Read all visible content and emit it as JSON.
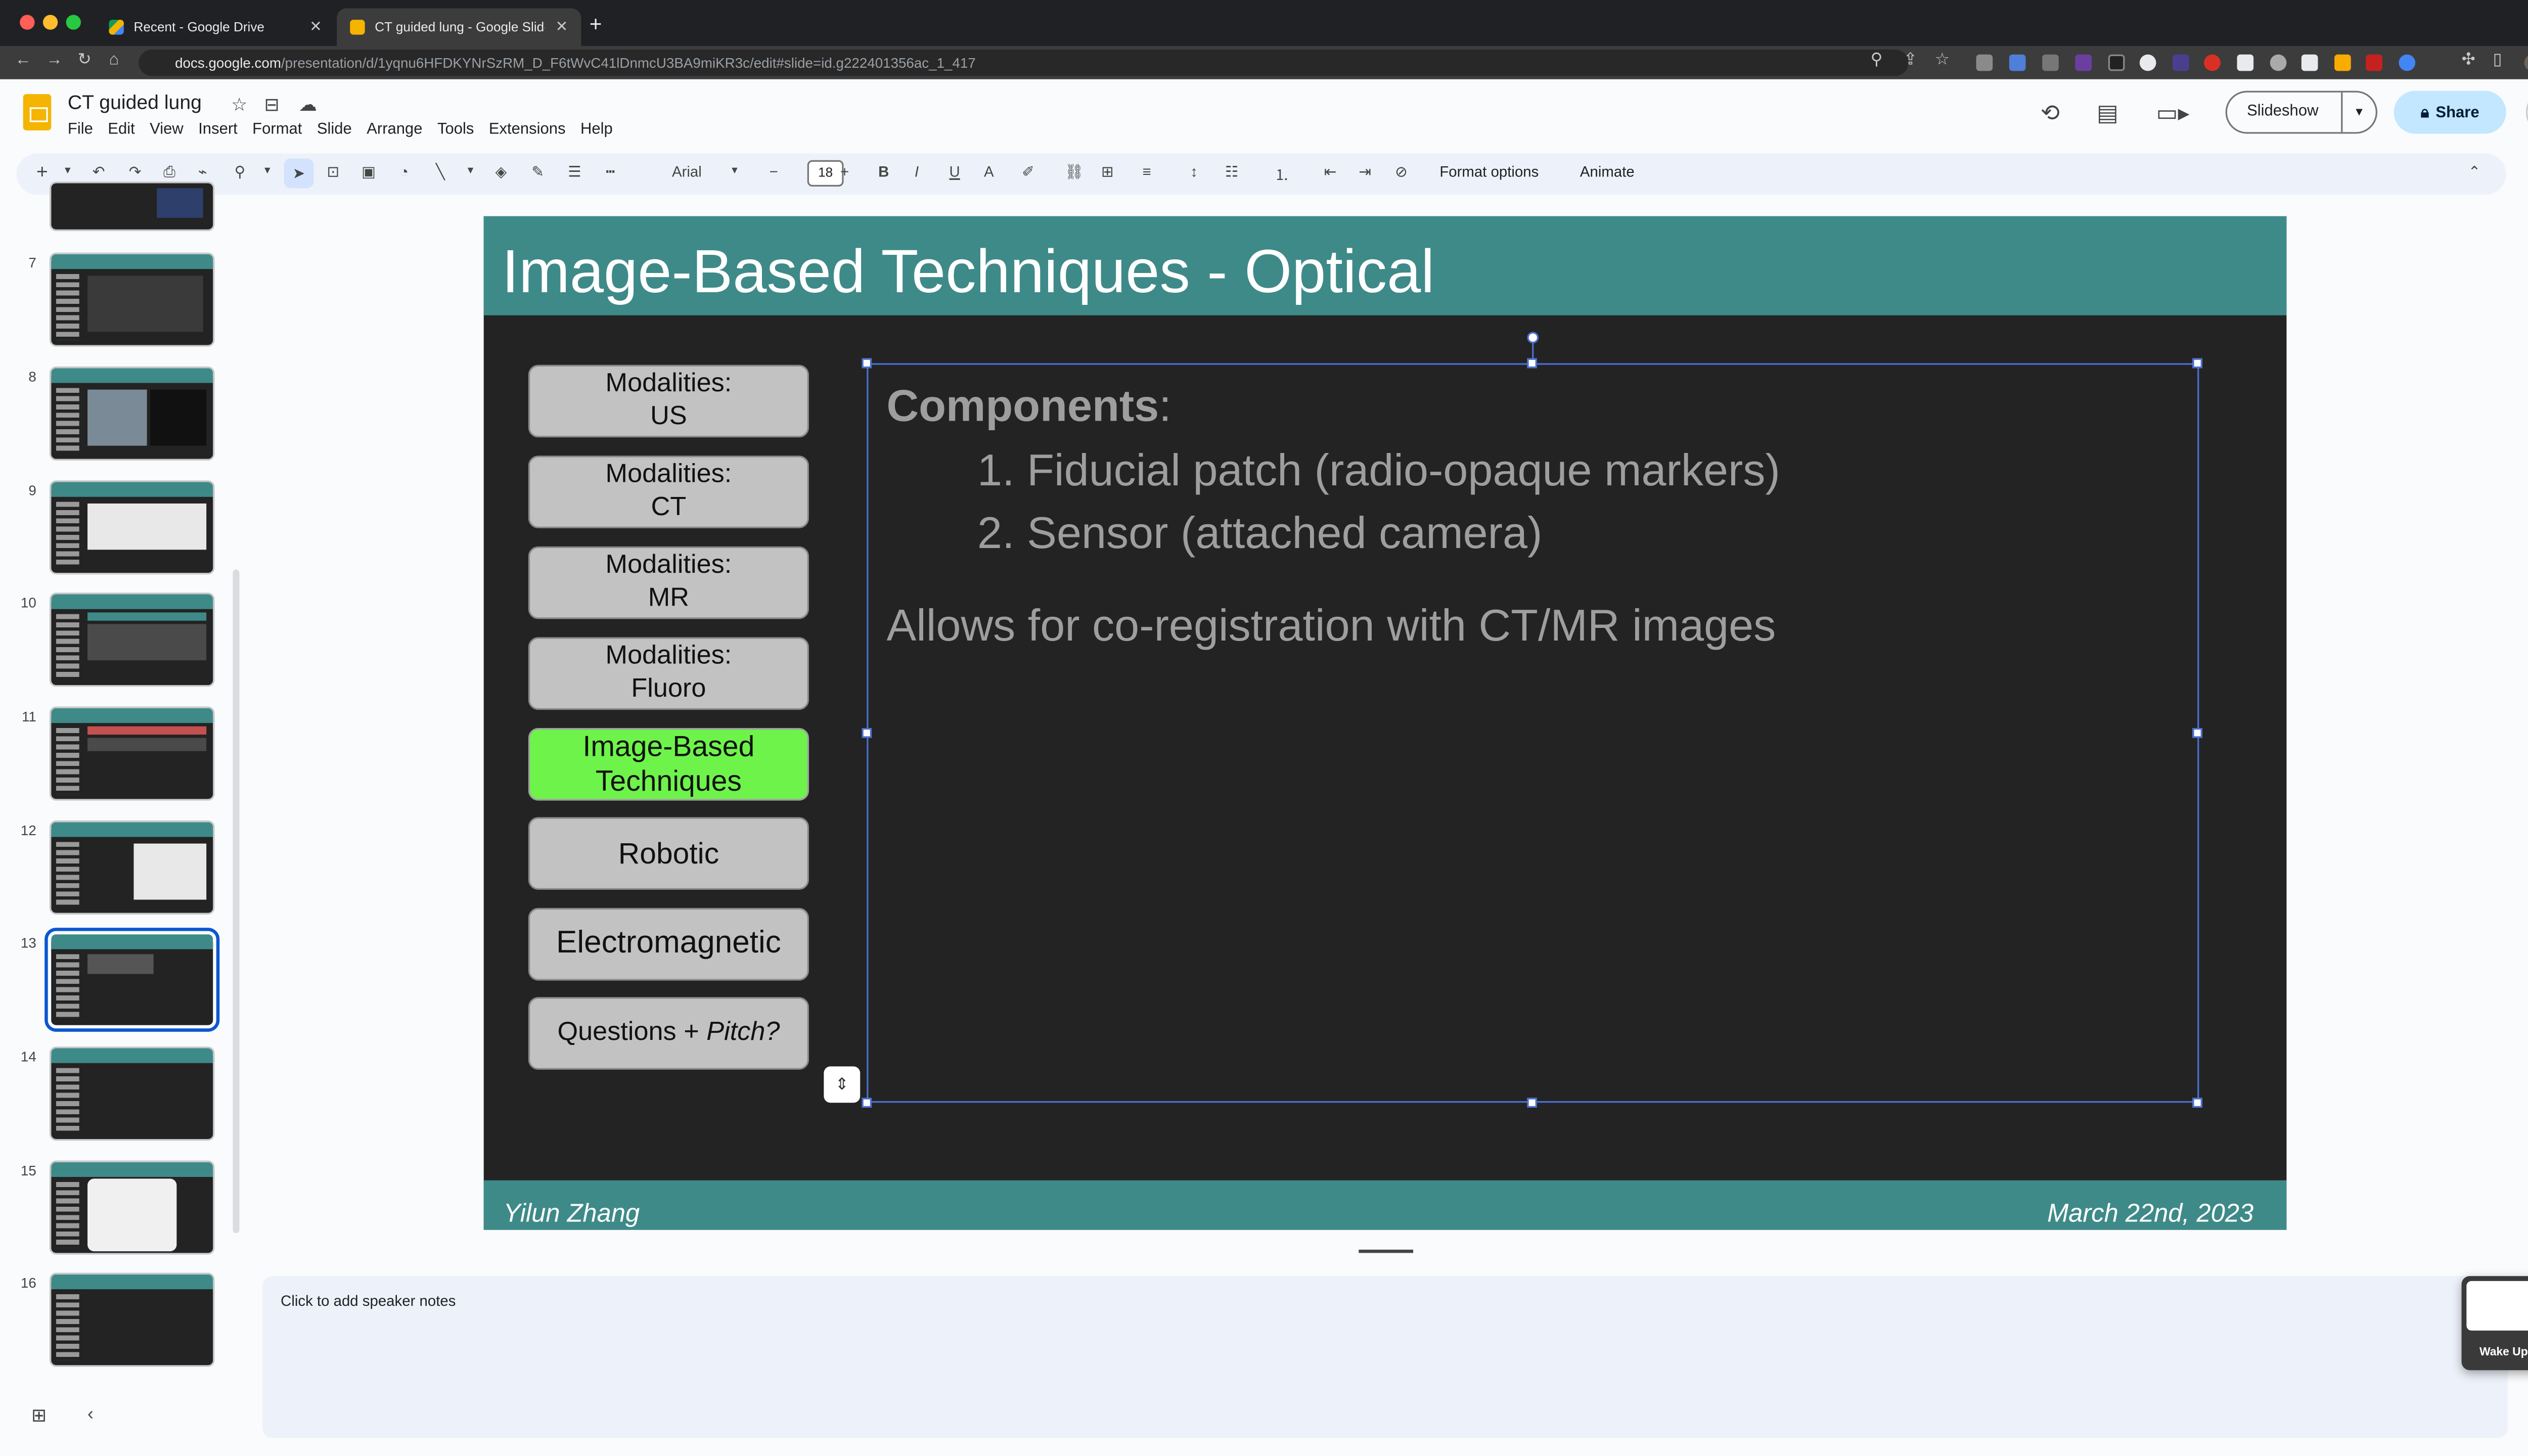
{
  "browser": {
    "tabs": [
      {
        "title": "Recent - Google Drive",
        "active": false
      },
      {
        "title": "CT guided lung - Google Slides",
        "active": true
      }
    ],
    "url_host": "docs.google.com",
    "url_path": "/presentation/d/1yqnu6HFDKYNrSzRM_D_F6tWvC41lDnmcU3BA9miKR3c/edit#slide=id.g222401356ac_1_417"
  },
  "doc": {
    "title": "CT guided lung",
    "menu": [
      "File",
      "Edit",
      "View",
      "Insert",
      "Format",
      "Slide",
      "Arrange",
      "Tools",
      "Extensions",
      "Help"
    ],
    "slideshow_label": "Slideshow",
    "share_label": "Share"
  },
  "toolbar": {
    "font": "Arial",
    "font_size": "18",
    "format_options": "Format options",
    "animate": "Animate"
  },
  "filmstrip": {
    "numbers": [
      "7",
      "8",
      "9",
      "10",
      "11",
      "12",
      "13",
      "14",
      "15",
      "16"
    ],
    "selected": "13"
  },
  "slide": {
    "title": "Image-Based Techniques - Optical",
    "nav": [
      {
        "line1": "Modalities:",
        "line2": "US"
      },
      {
        "line1": "Modalities:",
        "line2": "CT"
      },
      {
        "line1": "Modalities:",
        "line2": "MR"
      },
      {
        "line1": "Modalities:",
        "line2": "Fluoro"
      },
      {
        "line1": "Image-Based",
        "line2": "Techniques"
      },
      {
        "line1": "Robotic",
        "line2": ""
      },
      {
        "line1": "Electromagnetic",
        "line2": ""
      },
      {
        "line1": "Questions + ",
        "line2": "Pitch?"
      }
    ],
    "components_label": "Components",
    "components_colon": ":",
    "list": [
      {
        "num": "1.",
        "text": "Fiducial patch (radio-opaque markers)"
      },
      {
        "num": "2.",
        "text": "Sensor (attached camera)"
      }
    ],
    "allows": "Allows for co-registration with CT/MR images",
    "author": "Yilun Zhang",
    "date": "March 22nd, 2023"
  },
  "notes": {
    "placeholder": "Click to add speaker notes"
  },
  "wake": {
    "label": "Wake Up"
  },
  "colors": {
    "teal": "#3e8a89",
    "slide_bg": "#232323",
    "active_green": "#6ef34b",
    "selection_blue": "#4a6fd0"
  }
}
